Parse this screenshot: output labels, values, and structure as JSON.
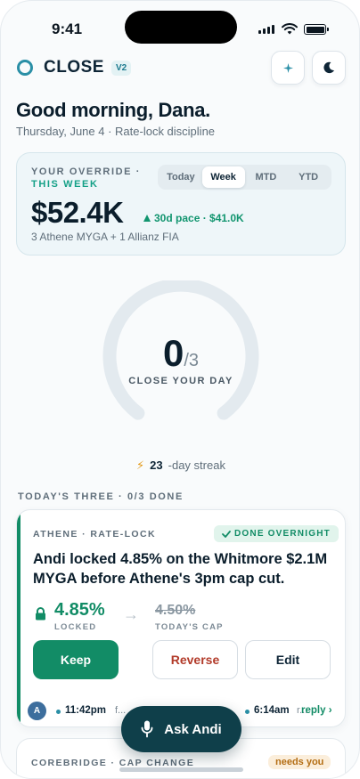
{
  "status_bar": {
    "time": "9:41"
  },
  "app": {
    "name": "CLOSE",
    "version_badge": "V2",
    "sparkle_icon": "sparkle-icon",
    "theme_icon": "moon-icon"
  },
  "greeting": {
    "title": "Good morning, Dana.",
    "subtitle": "Thursday, June 4 · Rate-lock discipline"
  },
  "override": {
    "label": "YOUR OVERRIDE ·",
    "label_accent": "THIS WEEK",
    "tabs": [
      "Today",
      "Week",
      "MTD",
      "YTD"
    ],
    "active_tab": "Week",
    "amount": "$52.4K",
    "pace": "30d pace · $41.0K",
    "detail": "3 Athene MYGA + 1 Allianz FIA"
  },
  "progress": {
    "done": "0",
    "total": "/3",
    "done_value": 0,
    "total_value": 3,
    "label": "CLOSE YOUR DAY"
  },
  "streak": {
    "count": "23",
    "label": "-day streak"
  },
  "section": {
    "title": "TODAY'S THREE · 0/3 DONE"
  },
  "task": {
    "tag": "ATHENE · RATE-LOCK",
    "badge": "DONE OVERNIGHT",
    "title": "Andi locked 4.85% on the Whitmore $2.1M MYGA before Athene's 3pm cap cut.",
    "locked_value": "4.85%",
    "locked_label": "LOCKED",
    "cap_value": "4.50%",
    "cap_label": "TODAY'S CAP",
    "actions": {
      "keep": "Keep",
      "reverse": "Reverse",
      "edit": "Edit"
    },
    "thread": {
      "avatar": "A",
      "time1": "11:42pm",
      "frag1": "f...",
      "time2": "6:14am",
      "frag2": "r...",
      "reply": "reply"
    }
  },
  "next_task": {
    "tag": "COREBRIDGE · CAP CHANGE",
    "badge": "needs you"
  },
  "fab": {
    "label": "Ask Andi"
  },
  "colors": {
    "accent": "#128c66",
    "brand": "#2a8fa6",
    "fab": "#0f3f4a",
    "danger": "#b23b2a"
  }
}
